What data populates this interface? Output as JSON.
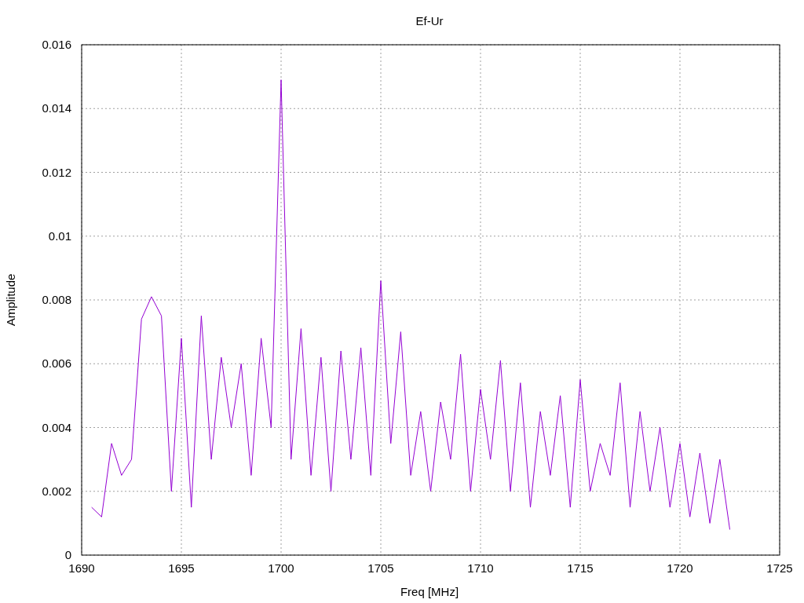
{
  "chart_data": {
    "type": "line",
    "grid": true,
    "title": "Ef-Ur",
    "xlabel": "Freq [MHz]",
    "ylabel": "Amplitude",
    "xlim": [
      1690,
      1725
    ],
    "ylim": [
      0,
      0.016
    ],
    "xticks": [
      1690,
      1695,
      1700,
      1705,
      1710,
      1715,
      1720,
      1725
    ],
    "yticks": [
      {
        "value": 0,
        "label": "0"
      },
      {
        "value": 0.002,
        "label": "0.002"
      },
      {
        "value": 0.004,
        "label": "0.004"
      },
      {
        "value": 0.006,
        "label": "0.006"
      },
      {
        "value": 0.008,
        "label": "0.008"
      },
      {
        "value": 0.01,
        "label": "0.01"
      },
      {
        "value": 0.012,
        "label": "0.012"
      },
      {
        "value": 0.014,
        "label": "0.014"
      },
      {
        "value": 0.016,
        "label": "0.016"
      }
    ],
    "x": [
      1690.5,
      1691,
      1691.5,
      1692,
      1692.5,
      1693,
      1693.5,
      1694,
      1694.5,
      1695,
      1695.5,
      1696,
      1696.5,
      1697,
      1697.5,
      1698,
      1698.5,
      1699,
      1699.5,
      1700,
      1700.5,
      1701,
      1701.5,
      1702,
      1702.5,
      1703,
      1703.5,
      1704,
      1704.5,
      1705,
      1705.5,
      1706,
      1706.5,
      1707,
      1707.5,
      1708,
      1708.5,
      1709,
      1709.5,
      1710,
      1710.5,
      1711,
      1711.5,
      1712,
      1712.5,
      1713,
      1713.5,
      1714,
      1714.5,
      1715,
      1715.5,
      1716,
      1716.5,
      1717,
      1717.5,
      1718,
      1718.5,
      1719,
      1719.5,
      1720,
      1720.5,
      1721,
      1721.5,
      1722,
      1722.5
    ],
    "series": [
      {
        "color": "#9400d3",
        "values": [
          0.0015,
          0.0012,
          0.0035,
          0.0025,
          0.003,
          0.0074,
          0.0081,
          0.0075,
          0.002,
          0.0068,
          0.0015,
          0.0075,
          0.003,
          0.0062,
          0.004,
          0.006,
          0.0025,
          0.0068,
          0.004,
          0.0149,
          0.003,
          0.0071,
          0.0025,
          0.0062,
          0.002,
          0.0064,
          0.003,
          0.0065,
          0.0025,
          0.0086,
          0.0035,
          0.007,
          0.0025,
          0.0045,
          0.002,
          0.0048,
          0.003,
          0.0063,
          0.002,
          0.0052,
          0.003,
          0.0061,
          0.002,
          0.0054,
          0.0015,
          0.0045,
          0.0025,
          0.005,
          0.0015,
          0.0055,
          0.002,
          0.0035,
          0.0025,
          0.0054,
          0.0015,
          0.0045,
          0.002,
          0.004,
          0.0015,
          0.0035,
          0.0012,
          0.0032,
          0.001,
          0.003,
          0.0008
        ]
      }
    ]
  }
}
